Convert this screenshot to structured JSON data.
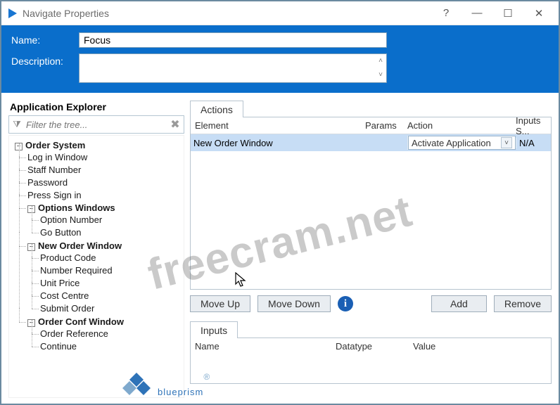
{
  "window": {
    "title": "Navigate Properties"
  },
  "header": {
    "name_label": "Name:",
    "name_value": "Focus",
    "description_label": "Description:",
    "description_value": ""
  },
  "explorer": {
    "title": "Application Explorer",
    "filter_placeholder": "Filter the tree...",
    "root": {
      "label": "Order System",
      "children": [
        {
          "label": "Log in Window"
        },
        {
          "label": "Staff Number"
        },
        {
          "label": "Password"
        },
        {
          "label": "Press Sign in"
        },
        {
          "label": "Options Windows",
          "expandable": true,
          "children": [
            {
              "label": "Option Number"
            },
            {
              "label": "Go Button"
            }
          ]
        },
        {
          "label": "New Order Window",
          "expandable": true,
          "children": [
            {
              "label": "Product Code"
            },
            {
              "label": "Number Required"
            },
            {
              "label": "Unit Price"
            },
            {
              "label": "Cost Centre"
            },
            {
              "label": "Submit Order"
            }
          ]
        },
        {
          "label": "Order Conf Window",
          "expandable": true,
          "children": [
            {
              "label": "Order Reference"
            },
            {
              "label": "Continue"
            }
          ]
        }
      ]
    }
  },
  "actions": {
    "tab_label": "Actions",
    "columns": {
      "element": "Element",
      "params": "Params",
      "action": "Action",
      "inputs": "Inputs S..."
    },
    "rows": [
      {
        "element": "New Order Window",
        "params": "",
        "action": "Activate Application",
        "inputs": "N/A"
      }
    ],
    "buttons": {
      "move_up": "Move Up",
      "move_down": "Move Down",
      "add": "Add",
      "remove": "Remove"
    }
  },
  "inputs": {
    "tab_label": "Inputs",
    "columns": {
      "name": "Name",
      "datatype": "Datatype",
      "value": "Value"
    }
  },
  "watermark": "freecram.net",
  "brand": "blueprism"
}
